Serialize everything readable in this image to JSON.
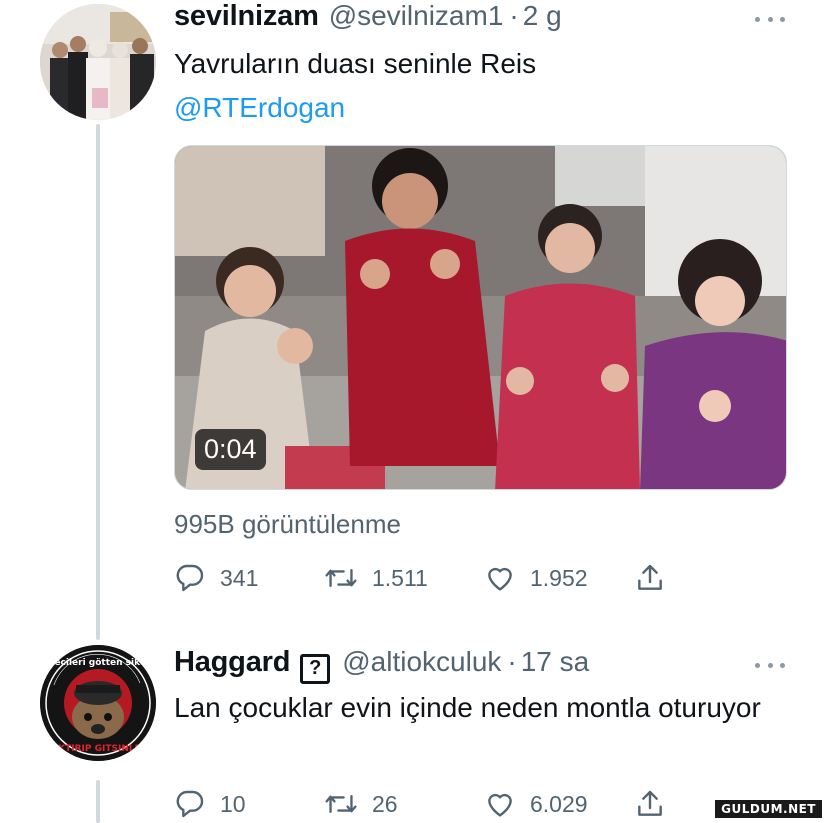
{
  "tweet1": {
    "display_name": "sevilnizam",
    "handle": "@sevilnizam1",
    "separator": "·",
    "time": "2 g",
    "text": "Yavruların duası seninle Reis",
    "mention": "@RTErdogan",
    "video_duration": "0:04",
    "views": "995B görüntülenme",
    "actions": {
      "replies": "341",
      "retweets": "1.511",
      "likes": "1.952"
    }
  },
  "tweet2": {
    "display_name": "Haggard",
    "badge": "?",
    "handle": "@altiokculuk",
    "separator": "·",
    "time": "17 sa",
    "text": "Lan çocuklar evin içinde neden montla oturuyor",
    "avatar_text_top": "Mültecileri götten sikeyim",
    "avatar_text_bottom": "SIKTIRIP GITSINLER",
    "actions": {
      "replies": "10",
      "retweets": "26",
      "likes": "6.029"
    }
  },
  "watermark": "GULDUM.NET",
  "colors": {
    "link": "#1d9bf0",
    "secondary_text": "#536471",
    "thread_line": "#cfd9de"
  },
  "icons": [
    "reply-icon",
    "retweet-icon",
    "like-icon",
    "share-icon",
    "more-icon"
  ]
}
